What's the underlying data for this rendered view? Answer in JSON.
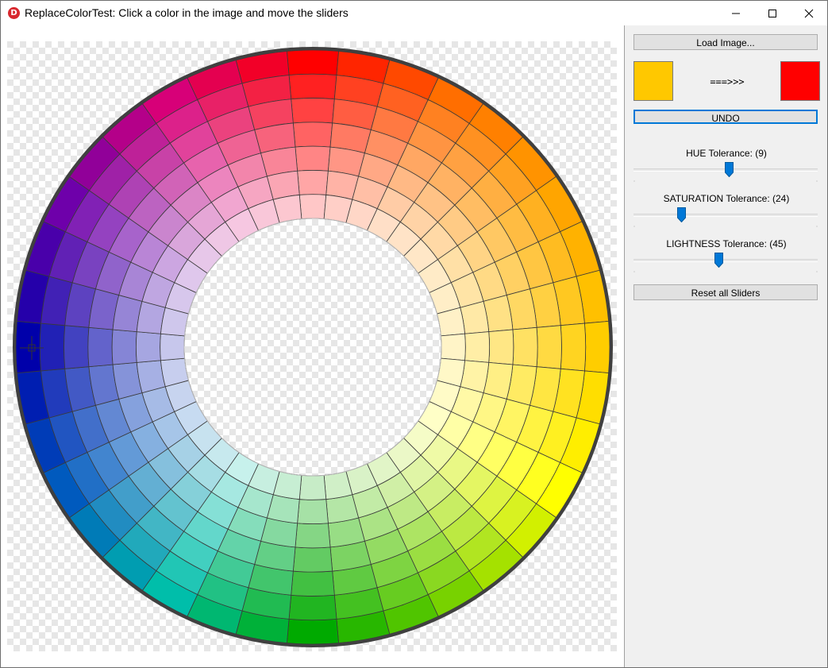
{
  "window": {
    "title": "ReplaceColorTest: Click a color in the image and move the sliders",
    "app_icon_glyph": "D",
    "controls": [
      "minimize-icon",
      "maximize-icon",
      "close-icon"
    ]
  },
  "panel": {
    "load_button": "Load Image...",
    "source_color": "#ffc800",
    "target_color": "#ff0000",
    "arrow_text": "===>>>",
    "undo_button": "UNDO",
    "sliders": [
      {
        "label": "HUE Tolerance: (9)",
        "value": 9,
        "fraction": 0.52
      },
      {
        "label": "SATURATION Tolerance: (24)",
        "value": 24,
        "fraction": 0.25
      },
      {
        "label": "LIGHTNESS Tolerance: (45)",
        "value": 45,
        "fraction": 0.46
      }
    ],
    "reset_button": "Reset all Sliders"
  },
  "image": {
    "description_icon": "crosshair-icon",
    "ring_rings": 7,
    "ring_segments": 36
  }
}
